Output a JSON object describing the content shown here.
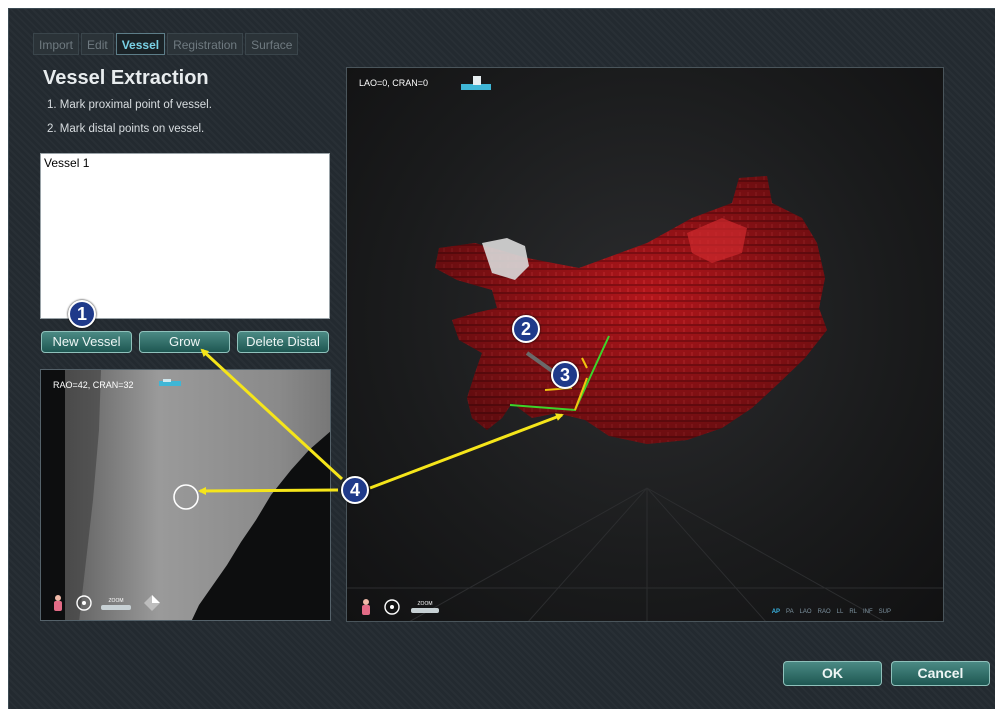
{
  "tabs": [
    "Import",
    "Edit",
    "Vessel",
    "Registration",
    "Surface"
  ],
  "active_tab": "Vessel",
  "title": "Vessel Extraction",
  "steps": [
    "1.  Mark proximal point of vessel.",
    "2.  Mark distal points on vessel."
  ],
  "vessel_list": [
    "Vessel 1"
  ],
  "buttons": {
    "new_vessel": "New Vessel",
    "grow": "Grow",
    "delete_distal": "Delete Distal",
    "ok": "OK",
    "cancel": "Cancel"
  },
  "view2d": {
    "angle_label": "RAO=42, CRAN=32",
    "zoom_label": "ZOOM"
  },
  "view3d": {
    "angle_label": "LAO=0, CRAN=0",
    "zoom_label": "ZOOM",
    "orientations": [
      "AP",
      "PA",
      "LAO",
      "RAO",
      "LL",
      "RL",
      "INF",
      "SUP"
    ],
    "active_orientation": "AP"
  },
  "callouts": [
    "1",
    "2",
    "3",
    "4"
  ],
  "colors": {
    "accent": "#7ad2e6",
    "button": "#2f6f69",
    "model_red": "#b3161b",
    "arrow": "#f5e51a",
    "callout": "#1f3a8a"
  },
  "icons": [
    "body-orientation-icon",
    "pan-icon",
    "zoom-icon",
    "c-arm-icon",
    "window-level-icon"
  ]
}
